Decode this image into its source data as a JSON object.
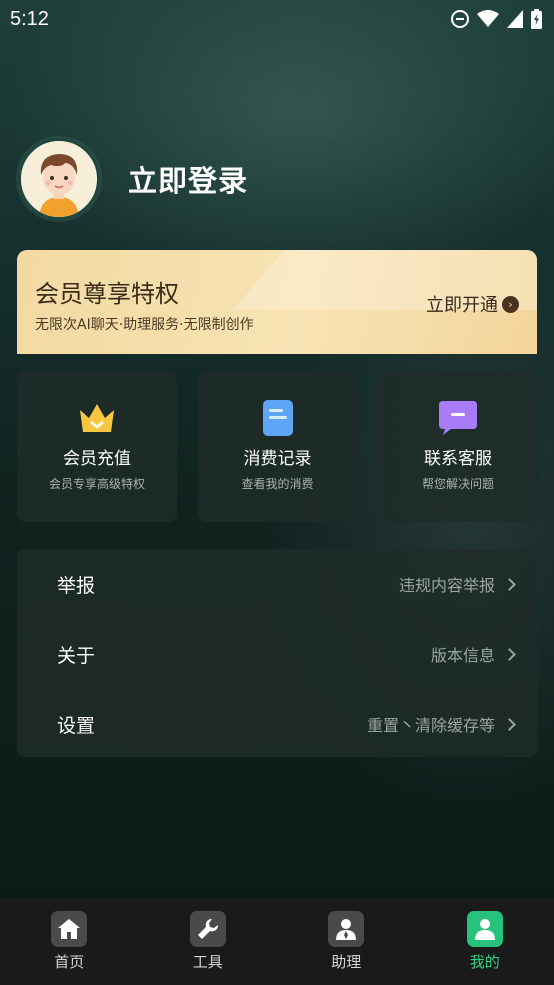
{
  "status_bar": {
    "time": "5:12"
  },
  "profile": {
    "login_text": "立即登录"
  },
  "vip": {
    "title": "会员尊享特权",
    "subtitle": "无限次AI聊天·助理服务·无限制创作",
    "action": "立即开通"
  },
  "cards": [
    {
      "title": "会员充值",
      "subtitle": "会员专享高级特权",
      "icon": "crown-icon"
    },
    {
      "title": "消费记录",
      "subtitle": "查看我的消费",
      "icon": "document-icon"
    },
    {
      "title": "联系客服",
      "subtitle": "帮您解决问题",
      "icon": "chat-bubble-icon"
    }
  ],
  "menu": [
    {
      "label": "举报",
      "value": "违规内容举报"
    },
    {
      "label": "关于",
      "value": "版本信息"
    },
    {
      "label": "设置",
      "value": "重置丶清除缓存等"
    }
  ],
  "tabs": [
    {
      "label": "首页",
      "icon": "home-icon"
    },
    {
      "label": "工具",
      "icon": "wrench-icon"
    },
    {
      "label": "助理",
      "icon": "assistant-icon"
    },
    {
      "label": "我的",
      "icon": "user-icon",
      "active": true
    }
  ],
  "colors": {
    "accent": "#2ed183",
    "vip_gold": "#f3d9a1"
  }
}
